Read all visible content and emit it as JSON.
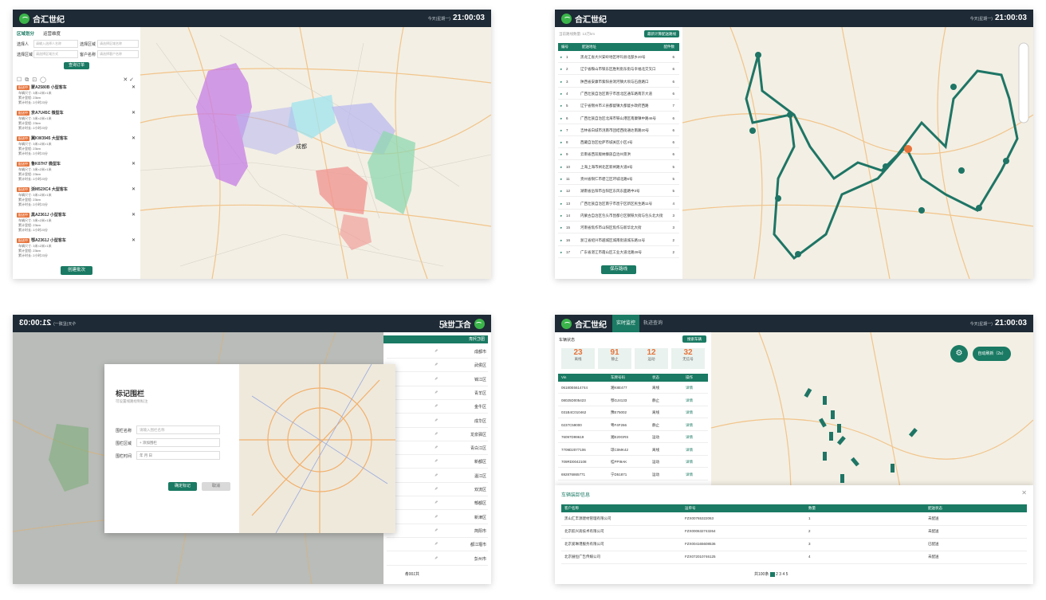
{
  "brand": {
    "name": "合汇世纪",
    "time": "21:00:03",
    "date": "今天(星期一)"
  },
  "colors": {
    "primary": "#1a7a63",
    "topbar": "#1e2a35",
    "orange": "#e8733a"
  },
  "panel1": {
    "tabs": [
      "区域划分",
      "运营维度"
    ],
    "filters": [
      {
        "label": "选择人",
        "placeholder": "请输入选择人名称"
      },
      {
        "label": "选择区域",
        "placeholder": "请选择区域名称"
      },
      {
        "label": "选择区域",
        "placeholder": "请选择区域方式"
      },
      {
        "label": "客户名称",
        "placeholder": "请选择客户名称"
      }
    ],
    "search_button": "查询订单",
    "cards": [
      {
        "tag": "配送中",
        "plate": "蒙A2580B 小型客车"
      },
      {
        "tag": "配送中",
        "plate": "京A7U45C 微型车"
      },
      {
        "tag": "配送中",
        "plate": "冀KW3945 大型客车"
      },
      {
        "tag": "配送中",
        "plate": "鲁K07H7 微型车"
      },
      {
        "tag": "配送中",
        "plate": "浙M52XC4 大型客车"
      },
      {
        "tag": "配送中",
        "plate": "黑A2361J 小型客车"
      },
      {
        "tag": "配送中",
        "plate": "鄂A2361J 小型客车"
      }
    ],
    "card_lines": [
      "车辆尺寸: 3米×2米×1米",
      "累计里程: 23km",
      "累计时长: 2小时23分"
    ],
    "create_button": "创建批次",
    "city": "成都"
  },
  "panel2": {
    "header_label": "当前路线数量: 13万km",
    "plan_button": "最新计算配送路线",
    "columns": [
      "编号",
      "配送地址",
      "配件数"
    ],
    "rows": [
      {
        "id": "1",
        "addr": "黑龙江省大兴安岭地区呼玛县北部乡20号",
        "n": "6"
      },
      {
        "id": "2",
        "addr": "辽宁省鞍山市铁东区胜利街东街与幸福北交叉口",
        "n": "6"
      },
      {
        "id": "3",
        "addr": "陕西省安康市紫阳县洞河镇大坝与石盘路口",
        "n": "6"
      },
      {
        "id": "4",
        "addr": "广西壮族自治区南宁市邕北区通车路南京大道",
        "n": "6"
      },
      {
        "id": "5",
        "addr": "辽宁省锦州市义县都督镇大都督乡政府西路",
        "n": "7"
      },
      {
        "id": "6",
        "addr": "广西壮族自治区北海市铁山港区南康镇中路46号",
        "n": "6"
      },
      {
        "id": "7",
        "addr": "吉林省白城市洮南市团结西街通达南路20号",
        "n": "6"
      },
      {
        "id": "8",
        "addr": "西藏自治区拉萨市城关区小区4号",
        "n": "6"
      },
      {
        "id": "9",
        "addr": "云南省西双版纳傣族自治州景洪",
        "n": "6"
      },
      {
        "id": "10",
        "addr": "上海上海市闸北区新闸路大道8号",
        "n": "5"
      },
      {
        "id": "11",
        "addr": "贵州省铜仁市碧江区环城北路6号",
        "n": "5"
      },
      {
        "id": "12",
        "addr": "湖南省岳阳市岳阳区东风东面路中3号",
        "n": "5"
      },
      {
        "id": "13",
        "addr": "广西壮族自治区南宁市邕宁区新区民生路11号",
        "n": "4"
      },
      {
        "id": "14",
        "addr": "内蒙古自治区包头市昆都仑区钢铁大街与包头北大街",
        "n": "3"
      },
      {
        "id": "15",
        "addr": "河南省焦作市山阳区焦作与新华北大街",
        "n": "3"
      },
      {
        "id": "16",
        "addr": "浙江省绍兴市越城区城南街道城东路11号",
        "n": "2"
      },
      {
        "id": "17",
        "addr": "广东省湛江市霞山区工业大道北路28号",
        "n": "2"
      }
    ],
    "save_button": "保存路线"
  },
  "panel3": {
    "title": "标记围栏",
    "subtitle": "可设置线路绘制标注",
    "fields": [
      {
        "label": "围栏名称",
        "placeholder": "请输入围栏名称"
      },
      {
        "label": "围栏区域",
        "placeholder": "+ 添加围栏"
      },
      {
        "label": "围栏时间",
        "placeholder": "年 月 日"
      }
    ],
    "ok_button": "确定标记",
    "cancel_button": "取消",
    "list_header": "围栏列表",
    "list_items": [
      "成都市",
      "武侯区",
      "锦江区",
      "青羊区",
      "金牛区",
      "成华区",
      "龙泉驿区",
      "青白江区",
      "新都区",
      "温江区",
      "双流区",
      "郫都区",
      "新津区",
      "简阳市",
      "都江堰市",
      "彭州市"
    ],
    "pager": "共100条"
  },
  "panel4": {
    "tabs": [
      "实时监控",
      "轨迹查询"
    ],
    "stats": [
      {
        "value": "23",
        "label": "离线"
      },
      {
        "value": "91",
        "label": "静止"
      },
      {
        "value": "12",
        "label": "运动"
      },
      {
        "value": "32",
        "label": "无信号"
      }
    ],
    "search_label": "车辆状态",
    "search_button": "搜索车辆",
    "columns": [
      "Vin",
      "车牌号码",
      "状态",
      "操作"
    ],
    "rows": [
      {
        "vin": "06180E6614744",
        "plate": "湘K8E477",
        "status": "离线"
      },
      {
        "vin": "08025D005423",
        "plate": "鄂GJ4133",
        "status": "静止"
      },
      {
        "vin": "031B4C010462",
        "plate": "豫E75002",
        "status": "离线"
      },
      {
        "vin": "0237C59000",
        "plate": "粤F4F266",
        "status": "静止"
      },
      {
        "vin": "76097D99619",
        "plate": "湘E20GRS",
        "status": "运动"
      },
      {
        "vin": "7709D2077106",
        "plate": "琼C0MK42",
        "status": "离线"
      },
      {
        "vin": "709RD0042108",
        "plate": "桂PPI9AK",
        "status": "运动"
      },
      {
        "vin": "692876865771",
        "plate": "宁D51871",
        "status": "运动"
      }
    ],
    "op": "详情",
    "auto_button": "自动刷新（2s）",
    "dialog_title": "车辆装卸信息",
    "dialog_columns": [
      "客户名称",
      "运单号",
      "数量",
      "配送状态"
    ],
    "dialog_rows": [
      {
        "c": "黑山汇丰源建材管理有限公司",
        "no": "FZX00765322063",
        "q": "1",
        "s": "未配送"
      },
      {
        "c": "北京航兴高技术有限公司",
        "no": "FZX000632743264",
        "q": "2",
        "s": "未配送"
      },
      {
        "c": "北京爱琳港服务有限公司",
        "no": "FZX004165608536",
        "q": "3",
        "s": "已配送"
      },
      {
        "c": "北京展恒广告传媒公司",
        "no": "FZX072010746125",
        "q": "4",
        "s": "未配送"
      }
    ],
    "pager": "共100条"
  }
}
